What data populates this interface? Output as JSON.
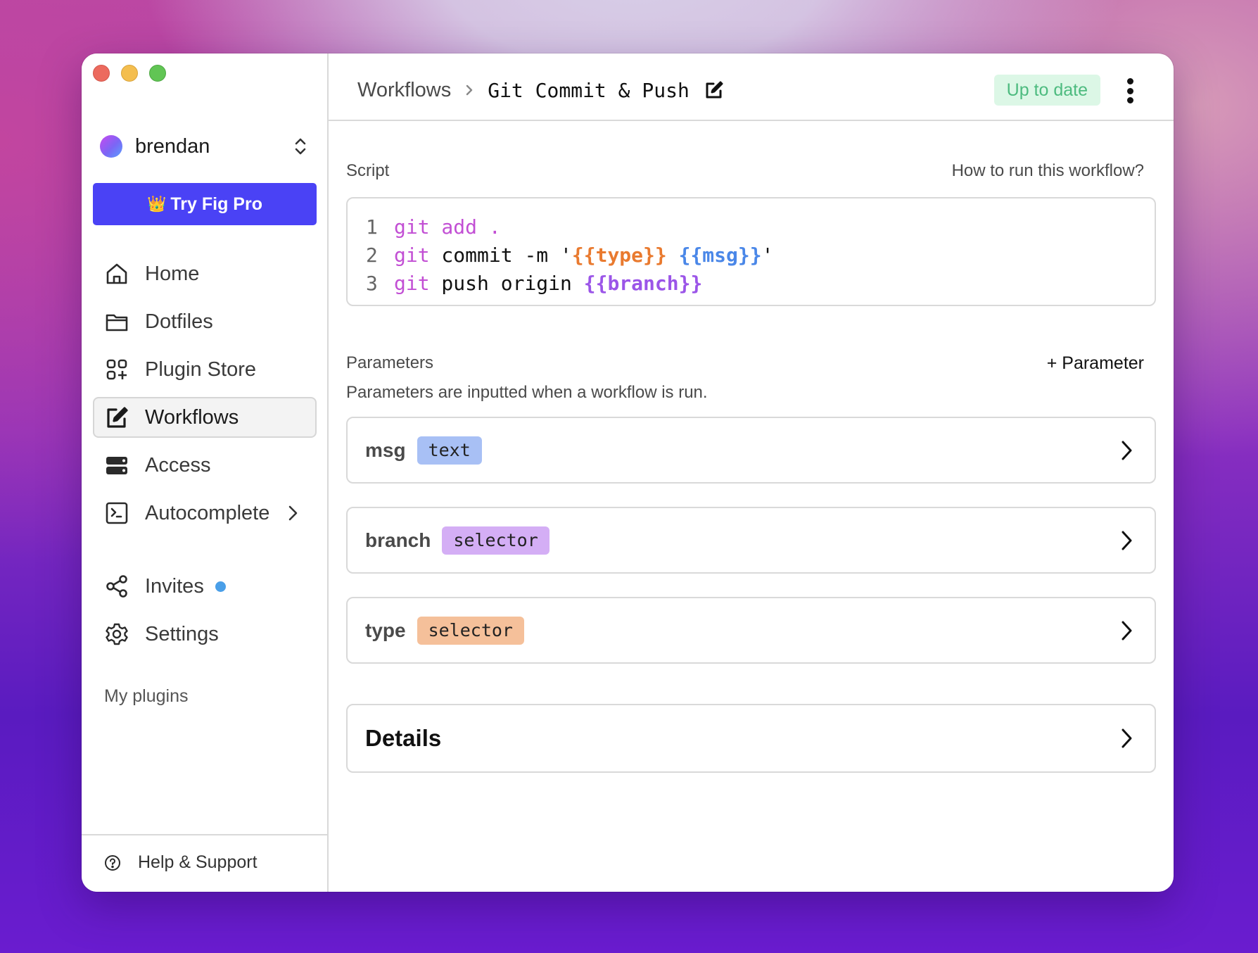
{
  "window": {
    "traffic_lights": [
      "close",
      "minimize",
      "maximize"
    ]
  },
  "sidebar": {
    "account": {
      "name": "brendan",
      "switcher_icon": "chevron-up-down-icon"
    },
    "pro_button": {
      "emoji": "👑",
      "label": "Try Fig Pro",
      "color": "#4a42f5"
    },
    "items": [
      {
        "label": "Home",
        "icon": "home-icon",
        "active": false
      },
      {
        "label": "Dotfiles",
        "icon": "folder-icon",
        "active": false
      },
      {
        "label": "Plugin Store",
        "icon": "plugin-grid-icon",
        "active": false
      },
      {
        "label": "Workflows",
        "icon": "edit-square-icon",
        "active": true
      },
      {
        "label": "Access",
        "icon": "server-icon",
        "active": false
      },
      {
        "label": "Autocomplete",
        "icon": "terminal-icon",
        "active": false,
        "has_submenu": true
      },
      {
        "label": "Invites",
        "icon": "share-icon",
        "active": false,
        "notification_dot": true
      },
      {
        "label": "Settings",
        "icon": "gear-icon",
        "active": false
      }
    ],
    "section_heading": "My plugins",
    "help": {
      "label": "Help & Support",
      "icon": "question-circle-icon"
    }
  },
  "header": {
    "breadcrumb_root": "Workflows",
    "title": "Git Commit & Push",
    "status": "Up to date",
    "status_color": "#4dbb7f"
  },
  "script": {
    "label": "Script",
    "help_link": "How to run this workflow?",
    "lines": [
      {
        "number": "1",
        "tokens": [
          {
            "text": "git",
            "kind": "keyword"
          },
          {
            "text": " add .",
            "kind": "keyword"
          }
        ]
      },
      {
        "number": "2",
        "tokens": [
          {
            "text": "git",
            "kind": "keyword"
          },
          {
            "text": " commit -m '",
            "kind": "plain"
          },
          {
            "text": "{{type}}",
            "kind": "param",
            "color": "#e97a2f"
          },
          {
            "text": " ",
            "kind": "plain"
          },
          {
            "text": "{{msg}}",
            "kind": "param",
            "color": "#4a87e8"
          },
          {
            "text": "'",
            "kind": "plain"
          }
        ]
      },
      {
        "number": "3",
        "tokens": [
          {
            "text": "git",
            "kind": "keyword"
          },
          {
            "text": " push origin ",
            "kind": "plain"
          },
          {
            "text": "{{branch}}",
            "kind": "param",
            "color": "#9b55e8"
          }
        ]
      }
    ]
  },
  "parameters": {
    "label": "Parameters",
    "add_button": "+ Parameter",
    "description": "Parameters are inputted when a workflow is run.",
    "items": [
      {
        "name": "msg",
        "type": "text",
        "badge_color": "#a8c0f5"
      },
      {
        "name": "branch",
        "type": "selector",
        "badge_color": "#d4aef5"
      },
      {
        "name": "type",
        "type": "selector",
        "badge_color": "#f5c09a"
      }
    ]
  },
  "details": {
    "label": "Details"
  }
}
